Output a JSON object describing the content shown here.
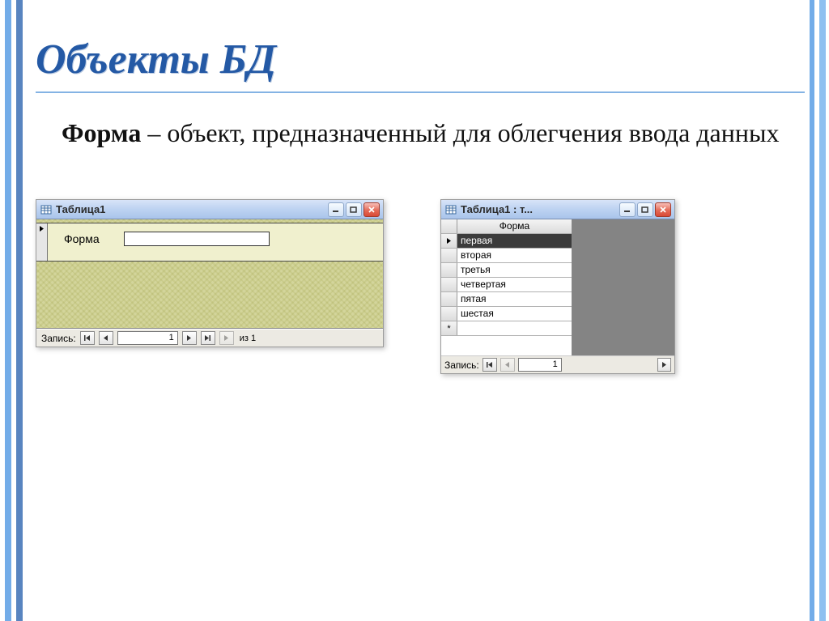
{
  "slide": {
    "title": "Объекты БД",
    "term": "Форма",
    "definition_rest": " – объект, предназначенный для облегчения ввода данных"
  },
  "form_window": {
    "title": "Таблица1",
    "field_label": "Форма",
    "field_value": "",
    "status_label": "Запись:",
    "record_number": "1",
    "of_text": "из 1"
  },
  "table_window": {
    "title": "Таблица1 : т...",
    "column_header": "Форма",
    "rows": [
      "первая",
      "вторая",
      "третья",
      "четвертая",
      "пятая",
      "шестая"
    ],
    "new_row_marker": "*",
    "status_label": "Запись:",
    "record_number": "1"
  }
}
